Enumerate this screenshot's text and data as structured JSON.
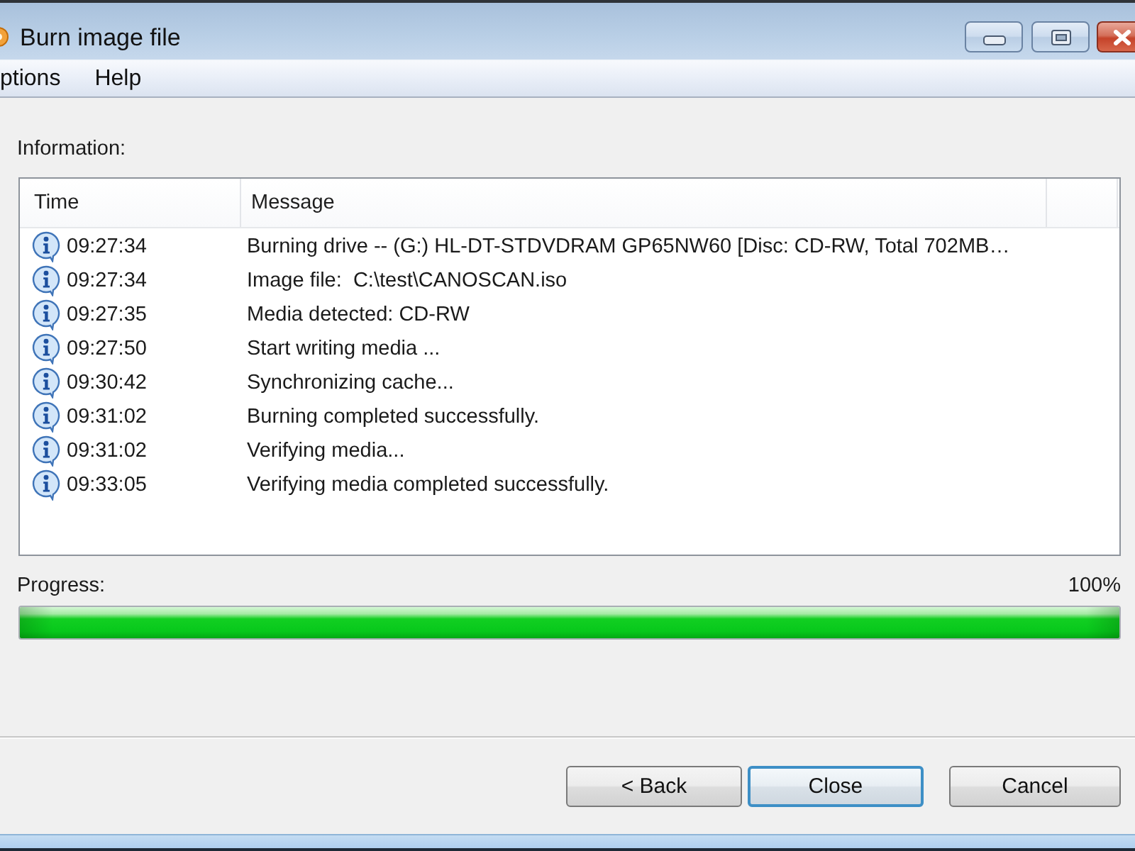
{
  "window": {
    "title": "Burn image file"
  },
  "menu": [
    {
      "label": "ptions"
    },
    {
      "label": "Help"
    }
  ],
  "information": {
    "label": "Information:",
    "columns": [
      "Time",
      "Message"
    ],
    "rows": [
      {
        "time": "09:27:34",
        "message": "Burning drive -- (G:) HL-DT-STDVDRAM GP65NW60 [Disc: CD-RW, Total 702MB…"
      },
      {
        "time": "09:27:34",
        "message": "Image file:  C:\\test\\CANOSCAN.iso"
      },
      {
        "time": "09:27:35",
        "message": "Media detected: CD-RW"
      },
      {
        "time": "09:27:50",
        "message": "Start writing media ..."
      },
      {
        "time": "09:30:42",
        "message": "Synchronizing cache..."
      },
      {
        "time": "09:31:02",
        "message": "Burning completed successfully."
      },
      {
        "time": "09:31:02",
        "message": "Verifying media..."
      },
      {
        "time": "09:33:05",
        "message": "Verifying media completed successfully."
      }
    ]
  },
  "progress": {
    "label": "Progress:",
    "reading": "100%",
    "level": 1
  },
  "buttons": [
    {
      "label": "< Back",
      "focused": false
    },
    {
      "label": "Close",
      "focused": true
    },
    {
      "label": "Cancel",
      "focused": false
    }
  ]
}
